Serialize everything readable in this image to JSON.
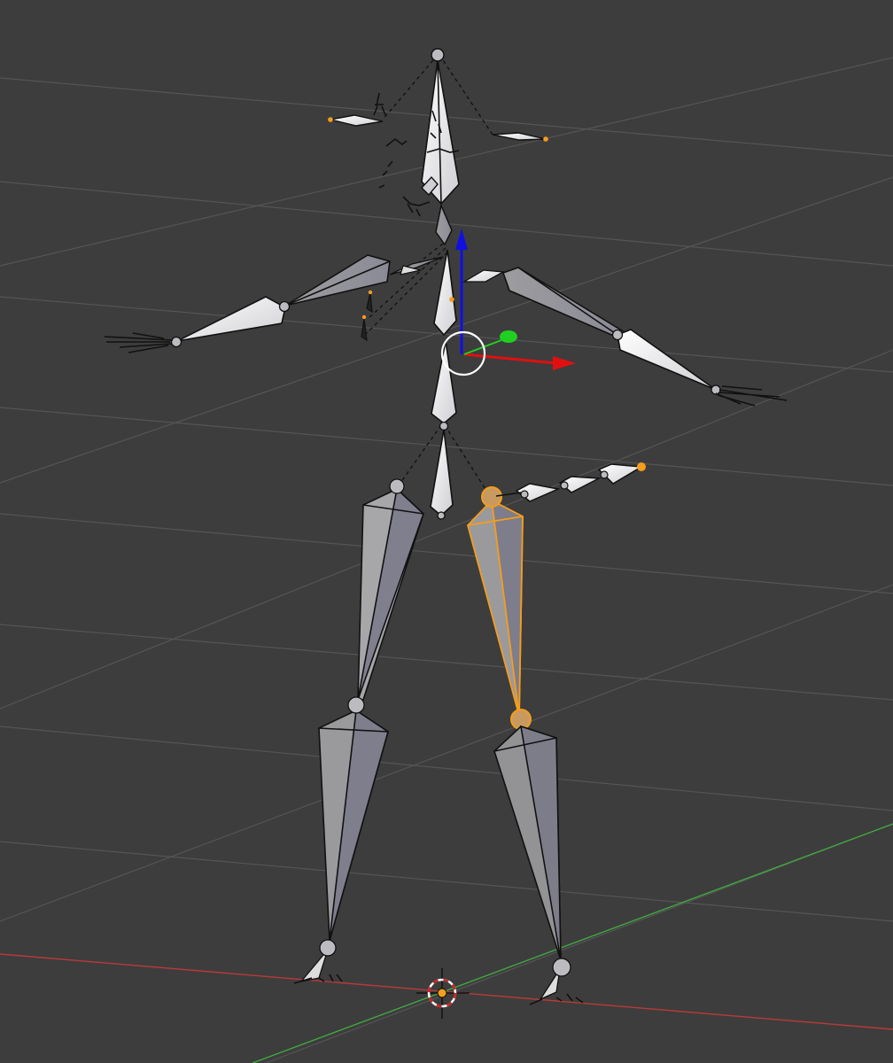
{
  "viewport": {
    "editor": "3D Viewport",
    "background_color": "#3d3d3d",
    "grid_color": "#555555",
    "x_axis_color": "#b83a3a",
    "y_axis_color": "#3fa83f"
  },
  "armature": {
    "bone_fill_light": "#f2f2f2",
    "bone_fill_mid": "#a4a4a8",
    "bone_fill_dark": "#7c7c8a",
    "selected_outline_color": "#f59d1d"
  },
  "gizmo": {
    "x_color": "#e01010",
    "y_color": "#20d020",
    "z_color": "#1010e0",
    "center_ring_color": "#ffffff"
  },
  "cursor": {
    "name": "3d-cursor",
    "ring_colors": [
      "#cc2020",
      "#ffffff"
    ]
  }
}
